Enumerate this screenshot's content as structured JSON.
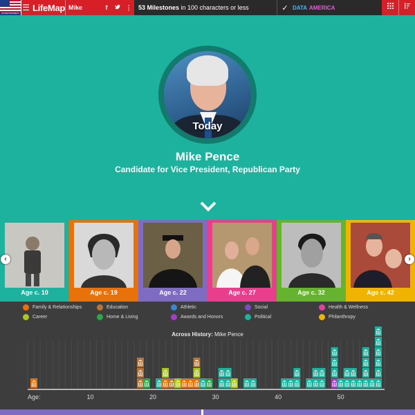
{
  "topbar": {
    "flag_caption": "ENTERTAINMENT",
    "menu_icon": "hamburger-icon",
    "logo": "LifeMap",
    "person_name": "Mike Pence",
    "social": [
      "f",
      "t",
      "⋮"
    ],
    "milestones_count": "53 Milestones",
    "milestones_text": " in 100 characters or less",
    "data_label_1": "DATA",
    "data_label_2": "AMERICA",
    "grid_icon": "grid-icon",
    "sort_icon": "sort-icon"
  },
  "hero": {
    "portrait_label": "Today",
    "name": "Mike Pence",
    "role": "Candidate for Vice President, Republican Party",
    "bg_color": "#1db29d"
  },
  "photos": [
    {
      "age": "Age c. 10",
      "color": "#1db29d"
    },
    {
      "age": "Age c. 19",
      "color": "#e8710a"
    },
    {
      "age": "Age c. 22",
      "color": "#7d6cc1"
    },
    {
      "age": "Age c. 27",
      "color": "#e83e8c"
    },
    {
      "age": "Age c. 32",
      "color": "#65b32e"
    },
    {
      "age": "Age c. 42",
      "color": "#f0b400"
    }
  ],
  "legend": [
    {
      "label": "Family & Relationships",
      "color": "#e8710a"
    },
    {
      "label": "Education",
      "color": "#b5753a"
    },
    {
      "label": "Athletic",
      "color": "#3a86d0"
    },
    {
      "label": "Social",
      "color": "#7d4cc1"
    },
    {
      "label": "Health & Wellness",
      "color": "#e040a0"
    },
    {
      "label": "Career",
      "color": "#a8c81e"
    },
    {
      "label": "Home & Living",
      "color": "#2aa84a"
    },
    {
      "label": "Awards and Honors",
      "color": "#a43cc4"
    },
    {
      "label": "Political",
      "color": "#1db29d"
    },
    {
      "label": "Philanthropy",
      "color": "#f0b400"
    }
  ],
  "chart": {
    "title_prefix": "Across History:",
    "title_name": "Mike Pence",
    "age_label": "Age:",
    "ticks": [
      "10",
      "20",
      "30",
      "40",
      "50"
    ]
  },
  "chart_data": {
    "type": "bar",
    "title": "Across History: Mike Pence",
    "xlabel": "Age:",
    "xticks": [
      10,
      20,
      30,
      40,
      50
    ],
    "xlim": [
      0,
      57
    ],
    "stacks": [
      {
        "age": 1,
        "items": [
          "#e8710a"
        ]
      },
      {
        "age": 18,
        "items": [
          "#b5753a",
          "#b5753a",
          "#b5753a"
        ]
      },
      {
        "age": 19,
        "items": [
          "#2aa84a"
        ]
      },
      {
        "age": 21,
        "items": [
          "#1db29d"
        ]
      },
      {
        "age": 22,
        "items": [
          "#e8710a",
          "#a8c81e"
        ]
      },
      {
        "age": 23,
        "items": [
          "#b5753a"
        ]
      },
      {
        "age": 24,
        "items": [
          "#a8c81e"
        ]
      },
      {
        "age": 25,
        "items": [
          "#e8710a"
        ]
      },
      {
        "age": 26,
        "items": [
          "#e8710a"
        ]
      },
      {
        "age": 27,
        "items": [
          "#e8710a",
          "#a8c81e",
          "#b5753a"
        ]
      },
      {
        "age": 28,
        "items": [
          "#1db29d"
        ]
      },
      {
        "age": 29,
        "items": [
          "#2aa84a"
        ]
      },
      {
        "age": 31,
        "items": [
          "#1db29d",
          "#1db29d"
        ]
      },
      {
        "age": 32,
        "items": [
          "#1db29d",
          "#1db29d"
        ]
      },
      {
        "age": 33,
        "items": [
          "#a8c81e"
        ]
      },
      {
        "age": 35,
        "items": [
          "#1db29d"
        ]
      },
      {
        "age": 36,
        "items": [
          "#1db29d"
        ]
      },
      {
        "age": 41,
        "items": [
          "#1db29d"
        ]
      },
      {
        "age": 42,
        "items": [
          "#1db29d"
        ]
      },
      {
        "age": 43,
        "items": [
          "#1db29d",
          "#1db29d"
        ]
      },
      {
        "age": 45,
        "items": [
          "#1db29d"
        ]
      },
      {
        "age": 46,
        "items": [
          "#1db29d",
          "#1db29d"
        ]
      },
      {
        "age": 47,
        "items": [
          "#1db29d",
          "#1db29d"
        ]
      },
      {
        "age": 49,
        "items": [
          "#a43cc4",
          "#1db29d",
          "#1db29d",
          "#1db29d"
        ]
      },
      {
        "age": 50,
        "items": [
          "#1db29d"
        ]
      },
      {
        "age": 51,
        "items": [
          "#1db29d",
          "#1db29d"
        ]
      },
      {
        "age": 52,
        "items": [
          "#1db29d",
          "#1db29d"
        ]
      },
      {
        "age": 53,
        "items": [
          "#1db29d"
        ]
      },
      {
        "age": 54,
        "items": [
          "#1db29d",
          "#1db29d",
          "#1db29d",
          "#1db29d"
        ]
      },
      {
        "age": 55,
        "items": [
          "#1db29d"
        ]
      },
      {
        "age": 56,
        "items": [
          "#1db29d",
          "#1db29d",
          "#1db29d",
          "#1db29d",
          "#1db29d",
          "#1db29d"
        ]
      }
    ]
  }
}
